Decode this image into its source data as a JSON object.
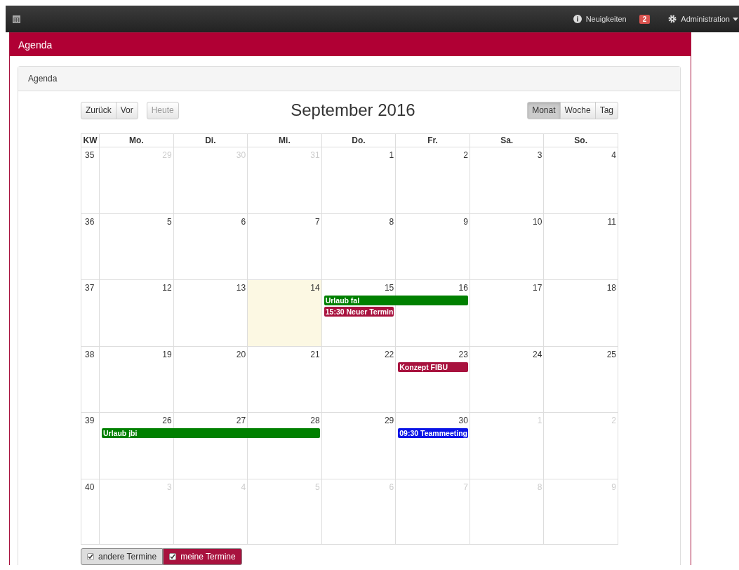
{
  "navbar": {
    "news": {
      "label": "Neuigkeiten",
      "count": "2"
    },
    "admin": {
      "label": "Administration"
    }
  },
  "page": {
    "title": "Agenda"
  },
  "panel": {
    "title": "Agenda"
  },
  "toolbar": {
    "nav_buttons": [
      {
        "label": "Zurück",
        "disabled": false
      },
      {
        "label": "Vor",
        "disabled": false
      }
    ],
    "today_button": {
      "label": "Heute",
      "disabled": true
    },
    "title": "September 2016",
    "views": [
      {
        "label": "Monat",
        "selected": true
      },
      {
        "label": "Woche",
        "selected": false
      },
      {
        "label": "Tag",
        "selected": false
      }
    ]
  },
  "calendar": {
    "week_header": "KW",
    "weekdays": [
      "Mo.",
      "Di.",
      "Mi.",
      "Do.",
      "Fr.",
      "Sa.",
      "So."
    ],
    "weeks": [
      {
        "kw": "35",
        "days": [
          {
            "label": "29",
            "other_month": true,
            "today": false
          },
          {
            "label": "30",
            "other_month": true,
            "today": false
          },
          {
            "label": "31",
            "other_month": true,
            "today": false
          },
          {
            "label": "1",
            "other_month": false,
            "today": false
          },
          {
            "label": "2",
            "other_month": false,
            "today": false
          },
          {
            "label": "3",
            "other_month": false,
            "today": false
          },
          {
            "label": "4",
            "other_month": false,
            "today": false
          }
        ]
      },
      {
        "kw": "36",
        "days": [
          {
            "label": "5",
            "other_month": false,
            "today": false
          },
          {
            "label": "6",
            "other_month": false,
            "today": false
          },
          {
            "label": "7",
            "other_month": false,
            "today": false
          },
          {
            "label": "8",
            "other_month": false,
            "today": false
          },
          {
            "label": "9",
            "other_month": false,
            "today": false
          },
          {
            "label": "10",
            "other_month": false,
            "today": false
          },
          {
            "label": "11",
            "other_month": false,
            "today": false
          }
        ]
      },
      {
        "kw": "37",
        "days": [
          {
            "label": "12",
            "other_month": false,
            "today": false
          },
          {
            "label": "13",
            "other_month": false,
            "today": false
          },
          {
            "label": "14",
            "other_month": false,
            "today": true
          },
          {
            "label": "15",
            "other_month": false,
            "today": false,
            "events": [
              {
                "kind": "event",
                "title": "Urlaub fal",
                "color": "#008000"
              },
              {
                "kind": "event",
                "title": "15:30 Neuer Termin",
                "color": "#a8123e"
              }
            ]
          },
          {
            "label": "16",
            "other_month": false,
            "today": false,
            "events": [
              {
                "kind": "continuation"
              }
            ]
          },
          {
            "label": "17",
            "other_month": false,
            "today": false
          },
          {
            "label": "18",
            "other_month": false,
            "today": false
          }
        ]
      },
      {
        "kw": "38",
        "days": [
          {
            "label": "19",
            "other_month": false,
            "today": false
          },
          {
            "label": "20",
            "other_month": false,
            "today": false
          },
          {
            "label": "21",
            "other_month": false,
            "today": false
          },
          {
            "label": "22",
            "other_month": false,
            "today": false
          },
          {
            "label": "23",
            "other_month": false,
            "today": false,
            "events": [
              {
                "kind": "event",
                "title": "Konzept FIBU",
                "color": "#a8123e"
              }
            ]
          },
          {
            "label": "24",
            "other_month": false,
            "today": false
          },
          {
            "label": "25",
            "other_month": false,
            "today": false
          }
        ]
      },
      {
        "kw": "39",
        "days": [
          {
            "label": "26",
            "other_month": false,
            "today": false,
            "events": [
              {
                "kind": "event",
                "title": "Urlaub jbi",
                "color": "#008000"
              }
            ]
          },
          {
            "label": "27",
            "other_month": false,
            "today": false,
            "events": [
              {
                "kind": "continuation"
              }
            ]
          },
          {
            "label": "28",
            "other_month": false,
            "today": false,
            "events": [
              {
                "kind": "continuation"
              }
            ]
          },
          {
            "label": "29",
            "other_month": false,
            "today": false
          },
          {
            "label": "30",
            "other_month": false,
            "today": false,
            "events": [
              {
                "kind": "event",
                "title": "09:30 Teammeeting",
                "color": "#0a14e6"
              }
            ]
          },
          {
            "label": "1",
            "other_month": true,
            "today": false
          },
          {
            "label": "2",
            "other_month": true,
            "today": false
          }
        ]
      },
      {
        "kw": "40",
        "days": [
          {
            "label": "3",
            "other_month": true,
            "today": false
          },
          {
            "label": "4",
            "other_month": true,
            "today": false
          },
          {
            "label": "5",
            "other_month": true,
            "today": false
          },
          {
            "label": "6",
            "other_month": true,
            "today": false
          },
          {
            "label": "7",
            "other_month": true,
            "today": false
          },
          {
            "label": "8",
            "other_month": true,
            "today": false
          },
          {
            "label": "9",
            "other_month": true,
            "today": false
          }
        ]
      }
    ]
  },
  "filters": [
    {
      "label": "andere Termine",
      "checked": true,
      "kind": "other"
    },
    {
      "label": "meine Termine",
      "checked": true,
      "kind": "mine"
    }
  ]
}
